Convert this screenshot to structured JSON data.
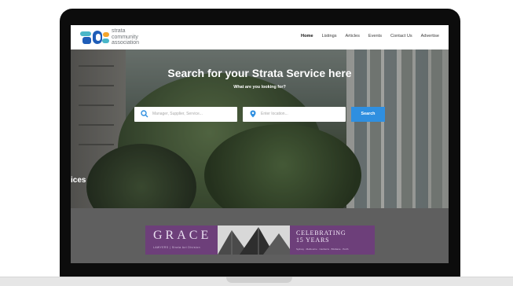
{
  "header": {
    "logo_lines": [
      "strata",
      "community",
      "association"
    ],
    "logo_colors": {
      "teal": "#49b6c8",
      "navy": "#1e5db8",
      "orange": "#f4a52a"
    },
    "nav": [
      "Home",
      "Listings",
      "Articles",
      "Events",
      "Contact Us",
      "Advertise"
    ],
    "active_nav": "Home"
  },
  "hero": {
    "title": "Search for your Strata Service here",
    "subtitle": "What are you looking for?",
    "search_placeholder": "Manager, Supplier, Service...",
    "location_placeholder": "Enter location...",
    "search_button": "Search",
    "side_text": "ices",
    "slider_count": 5,
    "slider_active": 1,
    "search_icon": "search-icon",
    "location_icon": "map-pin-icon"
  },
  "banner": {
    "name": "GRACE",
    "tagline": "LAWYERS | Strata Act Division",
    "headline_lines": [
      "CELEBRATING",
      "15 YEARS"
    ],
    "footer": "Sydney · Melbourne · Canberra · Brisbane · Perth"
  },
  "colors": {
    "button_blue": "#2f8fe0",
    "banner_purple": "#6d3f7a"
  }
}
